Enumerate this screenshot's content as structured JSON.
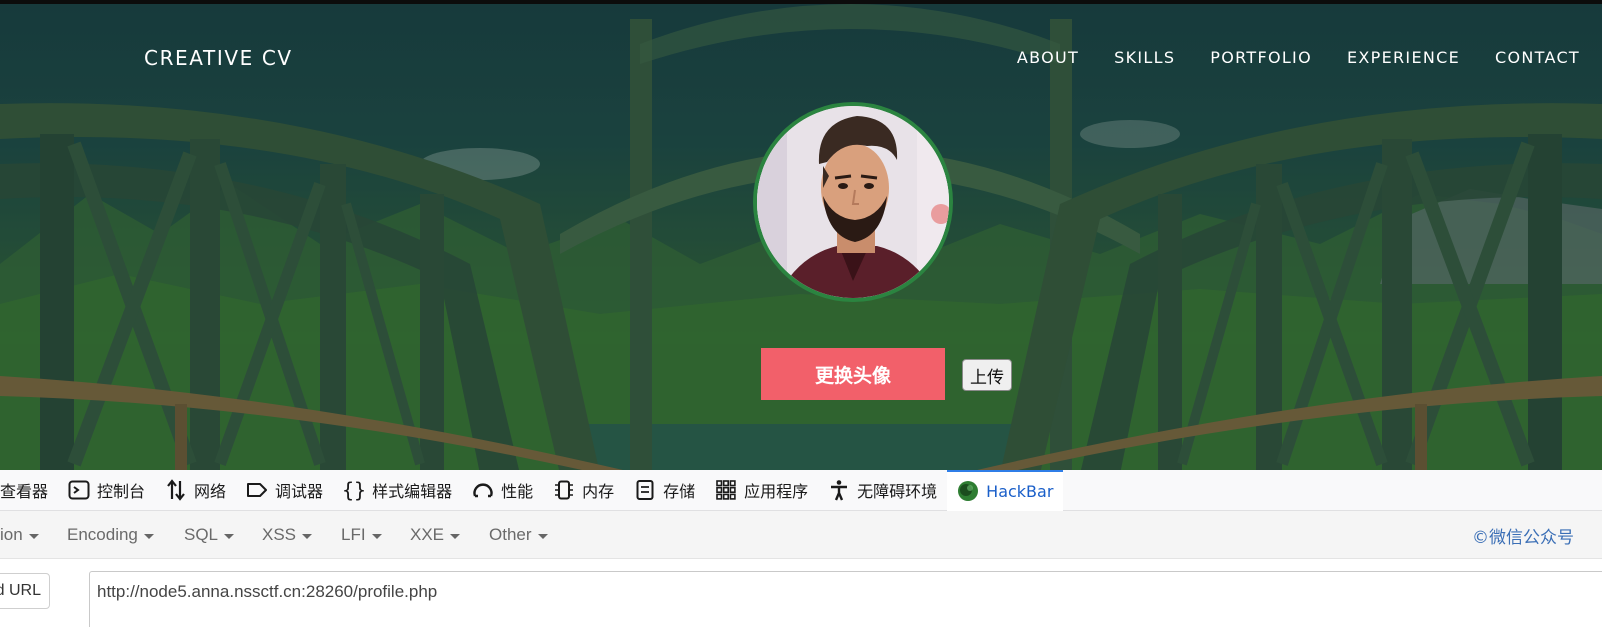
{
  "site": {
    "brand": "CREATIVE CV",
    "nav": [
      "ABOUT",
      "SKILLS",
      "PORTFOLIO",
      "EXPERIENCE",
      "CONTACT"
    ],
    "change_avatar_label": "更换头像",
    "upload_label": "上传"
  },
  "devtools": {
    "tabs": [
      {
        "label": "查看器",
        "icon": "inspector-icon"
      },
      {
        "label": "控制台",
        "icon": "console-icon"
      },
      {
        "label": "网络",
        "icon": "network-icon"
      },
      {
        "label": "调试器",
        "icon": "debugger-icon"
      },
      {
        "label": "样式编辑器",
        "icon": "style-editor-icon"
      },
      {
        "label": "性能",
        "icon": "performance-icon"
      },
      {
        "label": "内存",
        "icon": "memory-icon"
      },
      {
        "label": "存储",
        "icon": "storage-icon"
      },
      {
        "label": "应用程序",
        "icon": "application-icon"
      },
      {
        "label": "无障碍环境",
        "icon": "accessibility-icon"
      },
      {
        "label": "HackBar",
        "icon": "hackbar-icon"
      }
    ],
    "active_tab": "HackBar",
    "active_color": "#1a5fc9"
  },
  "hackbar": {
    "menu": [
      "ion",
      "Encoding",
      "SQL",
      "XSS",
      "LFI",
      "XXE",
      "Other"
    ],
    "wechat": "©微信公众号",
    "load_url_label": "d URL",
    "url_value": "http://node5.anna.nssctf.cn:28260/profile.php"
  },
  "colors": {
    "change_button": "#f2606a",
    "avatar_border": "#2b8440",
    "hero_tint": "#1c3f42"
  }
}
